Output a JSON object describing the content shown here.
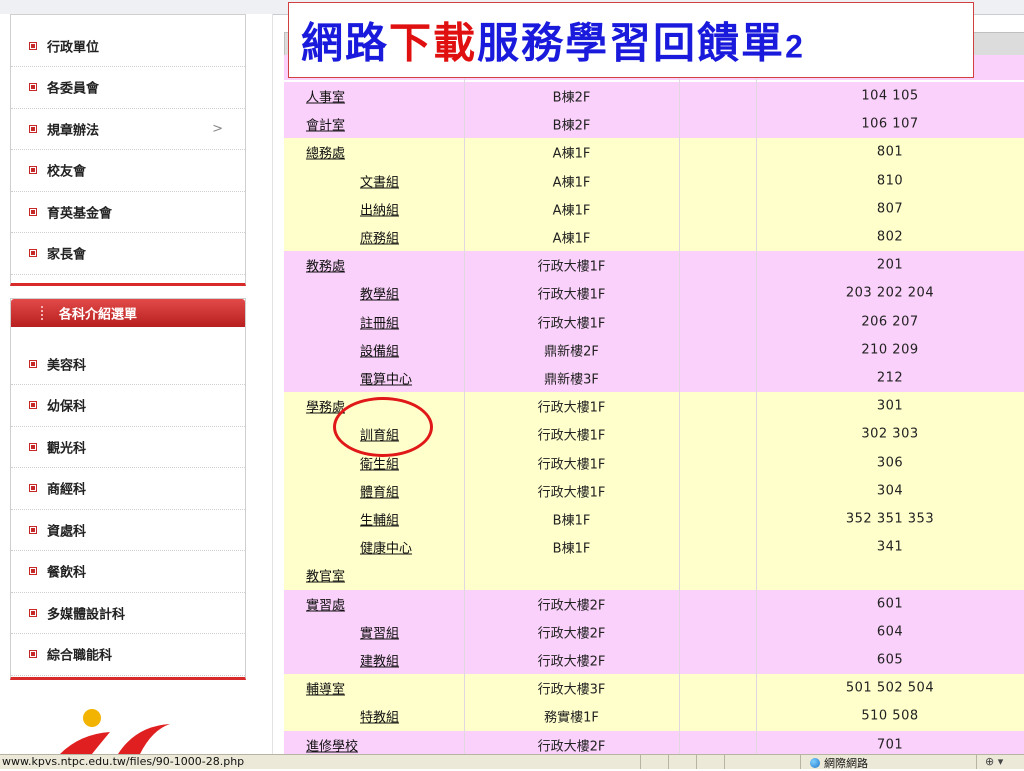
{
  "overlay_title": {
    "part1": "網路",
    "part2": "下",
    "part3": "載",
    "part4": "服務學習回饋單",
    "num": "2"
  },
  "sidebar": {
    "top_items": [
      {
        "label": "行政單位"
      },
      {
        "label": "各委員會"
      },
      {
        "label": "規章辦法",
        "has_chevron": true
      },
      {
        "label": "校友會"
      },
      {
        "label": "育英基金會"
      },
      {
        "label": "家長會"
      }
    ],
    "chevron": ">",
    "section_title": "各科介紹選單",
    "dept_items": [
      {
        "label": "美容科"
      },
      {
        "label": "幼保科"
      },
      {
        "label": "觀光科"
      },
      {
        "label": "商經科"
      },
      {
        "label": "資處科"
      },
      {
        "label": "餐飲科"
      },
      {
        "label": "多媒體設計科"
      },
      {
        "label": "綜合職能科"
      }
    ]
  },
  "directory": {
    "rows": [
      {
        "name": "人事室",
        "level": "top",
        "location": "B棟2F",
        "ext": "104  105",
        "bg": "pink"
      },
      {
        "name": "會計室",
        "level": "top",
        "location": "B棟2F",
        "ext": "106  107",
        "bg": "pink"
      },
      {
        "name": "總務處",
        "level": "top",
        "location": "A棟1F",
        "ext": "801",
        "bg": "yellow"
      },
      {
        "name": "文書組",
        "level": "sub",
        "location": "A棟1F",
        "ext": "810",
        "bg": "yellow"
      },
      {
        "name": "出納組",
        "level": "sub",
        "location": "A棟1F",
        "ext": "807",
        "bg": "yellow"
      },
      {
        "name": "庶務組",
        "level": "sub",
        "location": "A棟1F",
        "ext": "802",
        "bg": "yellow"
      },
      {
        "name": "教務處",
        "level": "top",
        "location": "行政大樓1F",
        "ext": "201",
        "bg": "pink"
      },
      {
        "name": "教學組",
        "level": "sub",
        "location": "行政大樓1F",
        "ext": "203  202  204",
        "bg": "pink"
      },
      {
        "name": "註冊組",
        "level": "sub",
        "location": "行政大樓1F",
        "ext": "206  207",
        "bg": "pink"
      },
      {
        "name": "設備組",
        "level": "sub",
        "location": "鼎新樓2F",
        "ext": "210  209",
        "bg": "pink"
      },
      {
        "name": "電算中心",
        "level": "sub",
        "location": "鼎新樓3F",
        "ext": "212",
        "bg": "pink"
      },
      {
        "name": "學務處",
        "level": "top",
        "location": "行政大樓1F",
        "ext": "301",
        "bg": "yellow"
      },
      {
        "name": "訓育組",
        "level": "sub",
        "location": "行政大樓1F",
        "ext": "302  303",
        "bg": "yellow"
      },
      {
        "name": "衛生組",
        "level": "sub",
        "location": "行政大樓1F",
        "ext": "306",
        "bg": "yellow"
      },
      {
        "name": "體育組",
        "level": "sub",
        "location": "行政大樓1F",
        "ext": "304",
        "bg": "yellow"
      },
      {
        "name": "生輔組",
        "level": "sub",
        "location": "B棟1F",
        "ext": "352  351  353",
        "bg": "yellow"
      },
      {
        "name": "健康中心",
        "level": "sub",
        "location": "B棟1F",
        "ext": "341",
        "bg": "yellow"
      },
      {
        "name": "教官室",
        "level": "top",
        "location": "",
        "ext": "",
        "bg": "yellow"
      },
      {
        "name": "實習處",
        "level": "top",
        "location": "行政大樓2F",
        "ext": "601",
        "bg": "pink"
      },
      {
        "name": "實習組",
        "level": "sub",
        "location": "行政大樓2F",
        "ext": "604",
        "bg": "pink"
      },
      {
        "name": "建教組",
        "level": "sub",
        "location": "行政大樓2F",
        "ext": "605",
        "bg": "pink"
      },
      {
        "name": "輔導室",
        "level": "top",
        "location": "行政大樓3F",
        "ext": "501  502  504",
        "bg": "yellow"
      },
      {
        "name": "特教組",
        "level": "sub",
        "location": "務實樓1F",
        "ext": "510  508",
        "bg": "yellow"
      },
      {
        "name": "進修學校",
        "level": "top",
        "location": "行政大樓2F",
        "ext": "701",
        "bg": "pink"
      }
    ]
  },
  "statusbar": {
    "url": "www.kpvs.ntpc.edu.tw/files/90-1000-28.php",
    "zone": "網際網路"
  },
  "colors": {
    "pink_row": "#fad1fa",
    "yellow_row": "#ffffcc",
    "accent_red": "#d82a2a",
    "title_blue": "#1a1adc",
    "title_red": "#e01010"
  }
}
